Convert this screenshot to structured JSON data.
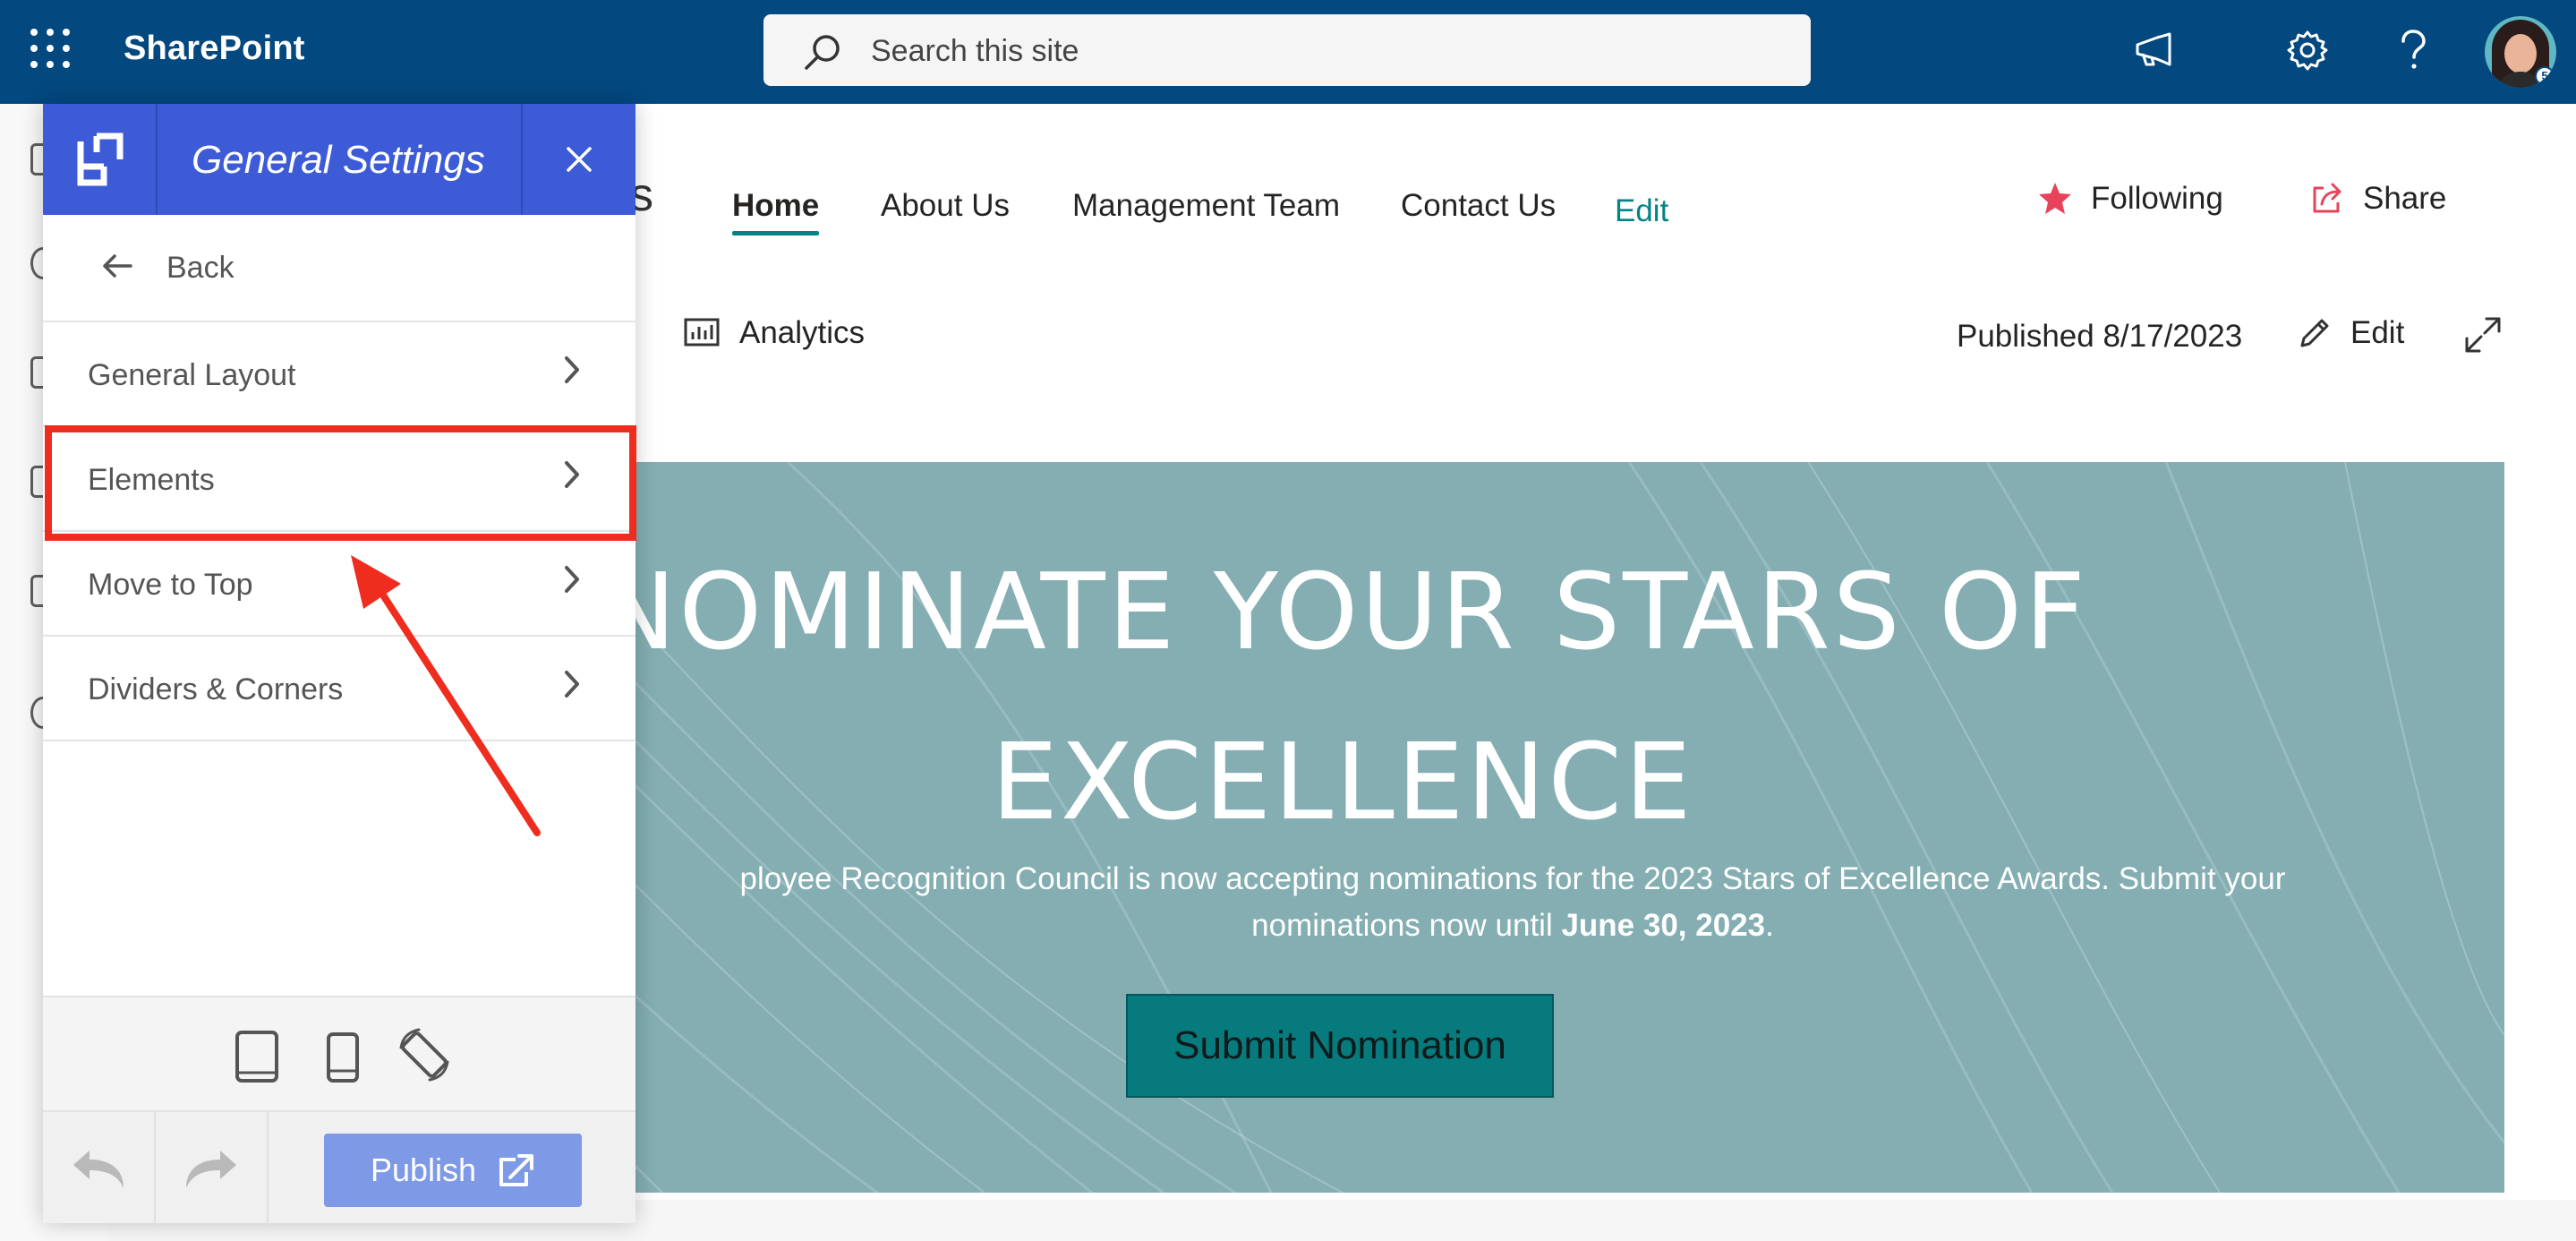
{
  "suitebar": {
    "app_name": "SharePoint",
    "search_placeholder": "Search this site",
    "avatar_badge": "5"
  },
  "site_nav": {
    "site_title_fragment": "s",
    "items": [
      {
        "label": "Home",
        "active": true
      },
      {
        "label": "About Us"
      },
      {
        "label": "Management Team"
      },
      {
        "label": "Contact Us"
      }
    ],
    "edit_label": "Edit",
    "following_label": "Following",
    "share_label": "Share"
  },
  "command_bar": {
    "analytics_label": "Analytics",
    "published_label": "Published 8/17/2023",
    "edit_label": "Edit"
  },
  "hero": {
    "title_line1": "NOMINATE YOUR STARS OF",
    "title_line2": "EXCELLENCE",
    "body_line1": "ployee Recognition Council is now accepting nominations for the 2023 Stars of Excellence Awards. Submit your",
    "body_line2_prefix": "nominations now until ",
    "body_line2_bold": "June 30, 2023",
    "body_line2_suffix": ".",
    "button_label": "Submit Nomination",
    "background_color": "#84aeb2",
    "button_color": "#067a7d"
  },
  "settings_panel": {
    "title": "General Settings",
    "back_label": "Back",
    "menu_items": [
      {
        "label": "General Layout"
      },
      {
        "label": "Elements",
        "highlighted": true
      },
      {
        "label": "Move to Top"
      },
      {
        "label": "Dividers & Corners"
      }
    ],
    "publish_label": "Publish",
    "header_color": "#3d5bd6",
    "highlight_color": "#ef2d1f"
  }
}
